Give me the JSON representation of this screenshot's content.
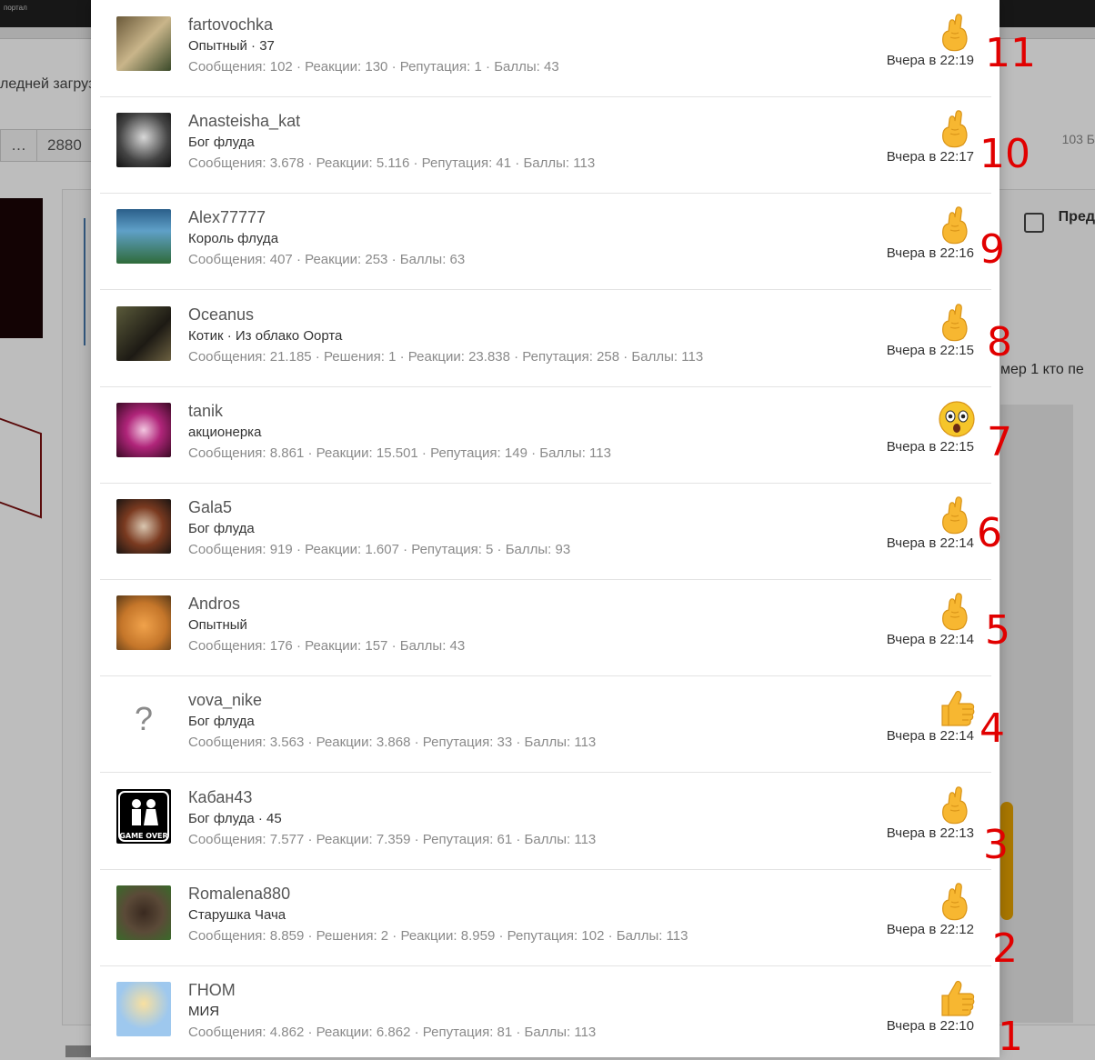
{
  "background": {
    "last_upload_text": "ледней загруз",
    "pager": [
      "…",
      "2880"
    ],
    "count_text": "103 Б",
    "preview_label": "Пред",
    "post_text": "мер 1 кто пе"
  },
  "colors": {
    "modal_bg": "#ffffff",
    "annotation_red": "#e10000",
    "stats_gray": "#8a8a8a",
    "emoji_yellow": "#f5b31e"
  },
  "reactions": [
    {
      "name": "fartovochka",
      "title": "Опытный · 37",
      "stats": "Сообщения: 102 · Реакции: 130 · Репутация: 1 · Баллы: 43",
      "time": "Вчера в 22:19",
      "reaction_icon": "crossed-fingers",
      "annotation": "11"
    },
    {
      "name": "Anasteisha_kat",
      "title": "Бог флуда",
      "stats": "Сообщения: 3.678 · Реакции: 5.116 · Репутация: 41 · Баллы: 113",
      "time": "Вчера в 22:17",
      "reaction_icon": "crossed-fingers",
      "annotation": "10"
    },
    {
      "name": "Alex77777",
      "title": "Король флуда",
      "stats": "Сообщения: 407 · Реакции: 253 · Баллы: 63",
      "time": "Вчера в 22:16",
      "reaction_icon": "crossed-fingers",
      "annotation": "9"
    },
    {
      "name": "Oceanus",
      "title": "Котик · Из облако Оорта",
      "stats": "Сообщения: 21.185 · Решения: 1 · Реакции: 23.838 · Репутация: 258 · Баллы: 113",
      "time": "Вчера в 22:15",
      "reaction_icon": "crossed-fingers",
      "annotation": "8"
    },
    {
      "name": "tanik",
      "title": "акционерка",
      "stats": "Сообщения: 8.861 · Реакции: 15.501 · Репутация: 149 · Баллы: 113",
      "time": "Вчера в 22:15",
      "reaction_icon": "astonished-face",
      "annotation": "7"
    },
    {
      "name": "Gala5",
      "title": "Бог флуда",
      "stats": "Сообщения: 919 · Реакции: 1.607 · Репутация: 5 · Баллы: 93",
      "time": "Вчера в 22:14",
      "reaction_icon": "crossed-fingers",
      "annotation": "6"
    },
    {
      "name": "Andros",
      "title": "Опытный",
      "stats": "Сообщения: 176 · Реакции: 157 · Баллы: 43",
      "time": "Вчера в 22:14",
      "reaction_icon": "crossed-fingers",
      "annotation": "5"
    },
    {
      "name": "vova_nike",
      "title": "Бог флуда",
      "stats": "Сообщения: 3.563 · Реакции: 3.868 · Репутация: 33 · Баллы: 113",
      "time": "Вчера в 22:14",
      "reaction_icon": "thumbs-up",
      "annotation": "4",
      "avatar_placeholder": "?"
    },
    {
      "name": "Кабан43",
      "title": "Бог флуда · 45",
      "stats": "Сообщения: 7.577 · Реакции: 7.359 · Репутация: 61 · Баллы: 113",
      "time": "Вчера в 22:13",
      "reaction_icon": "crossed-fingers",
      "annotation": "3",
      "avatar_text": "GAME OVER"
    },
    {
      "name": "Romalena880",
      "title": "Старушка Чача",
      "stats": "Сообщения: 8.859 · Решения: 2 · Реакции: 8.959 · Репутация: 102 · Баллы: 113",
      "time": "Вчера в 22:12",
      "reaction_icon": "crossed-fingers",
      "annotation": "2"
    },
    {
      "name": "ГНОМ",
      "title": "МИЯ",
      "stats": "Сообщения: 4.862 · Реакции: 6.862 · Репутация: 81 · Баллы: 113",
      "time": "Вчера в 22:10",
      "reaction_icon": "thumbs-up",
      "annotation": "1"
    }
  ]
}
